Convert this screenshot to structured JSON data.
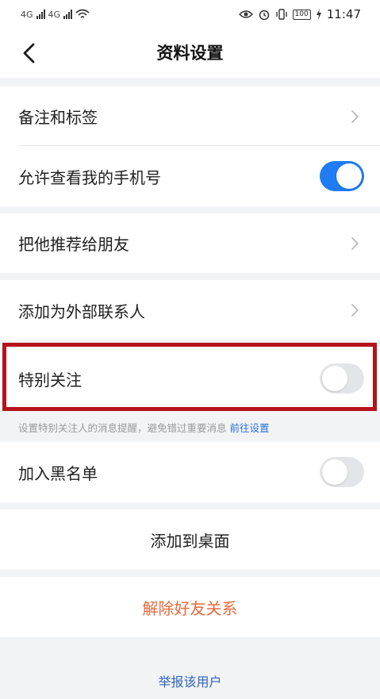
{
  "status_bar": {
    "signal_1": "4G",
    "signal_2": "4G",
    "battery": "100",
    "time": "11:47",
    "icons": [
      "signal-icon",
      "wifi-icon",
      "eye-icon",
      "alarm-icon",
      "vibrate-icon",
      "battery-icon",
      "charging-icon"
    ]
  },
  "header": {
    "title": "资料设置",
    "back_icon": "chevron-left-icon"
  },
  "settings": {
    "remark_tags": {
      "label": "备注和标签"
    },
    "allow_view_phone": {
      "label": "允许查看我的手机号",
      "enabled": true
    },
    "recommend_friend": {
      "label": "把他推荐给朋友"
    },
    "add_external_contact": {
      "label": "添加为外部联系人"
    },
    "special_follow": {
      "label": "特别关注",
      "enabled": false,
      "hint": "设置特别关注人的消息提醒，避免错过重要消息",
      "hint_link": "前往设置"
    },
    "blacklist": {
      "label": "加入黑名单",
      "enabled": false
    }
  },
  "actions": {
    "add_to_desktop": "添加到桌面",
    "remove_friend": "解除好友关系",
    "report_user": "举报该用户"
  },
  "colors": {
    "toggle_on": "#1f7cf2",
    "toggle_off": "#e4e5e8",
    "danger": "#e8693b",
    "link": "#2a6fd6",
    "highlight": "#b5121b",
    "background": "#f2f3f5"
  }
}
